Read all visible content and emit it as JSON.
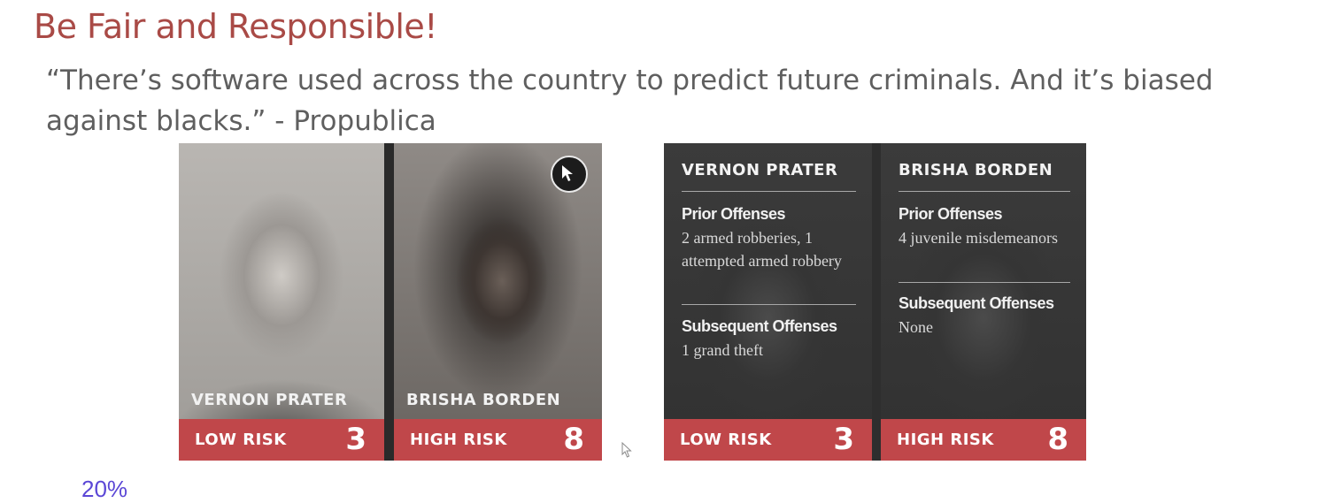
{
  "slide": {
    "title": "Be Fair and Responsible!",
    "quote": "“There’s software used across the country to predict future criminals. And it’s biased against blacks.” - Propublica",
    "bottom_fragment": "20%"
  },
  "photo_cards": [
    {
      "name": "VERNON PRATER",
      "risk_label": "LOW RISK",
      "risk_score": "3"
    },
    {
      "name": "BRISHA BORDEN",
      "risk_label": "HIGH RISK",
      "risk_score": "8"
    }
  ],
  "info_cards": [
    {
      "name": "VERNON PRATER",
      "prior_heading": "Prior Offenses",
      "prior_text": "2 armed robberies, 1 attempted armed robbery",
      "subsequent_heading": "Subsequent Offenses",
      "subsequent_text": "1 grand theft",
      "risk_label": "LOW RISK",
      "risk_score": "3"
    },
    {
      "name": "BRISHA BORDEN",
      "prior_heading": "Prior Offenses",
      "prior_text": "4 juvenile misdemeanors",
      "subsequent_heading": "Subsequent Offenses",
      "subsequent_text": "None",
      "risk_label": "HIGH RISK",
      "risk_score": "8"
    }
  ],
  "colors": {
    "title": "#a94a46",
    "risk_bar": "#c0474a",
    "fragment": "#5b47d6"
  },
  "icons": [
    "cursor-circle-icon",
    "mouse-pointer-icon"
  ]
}
